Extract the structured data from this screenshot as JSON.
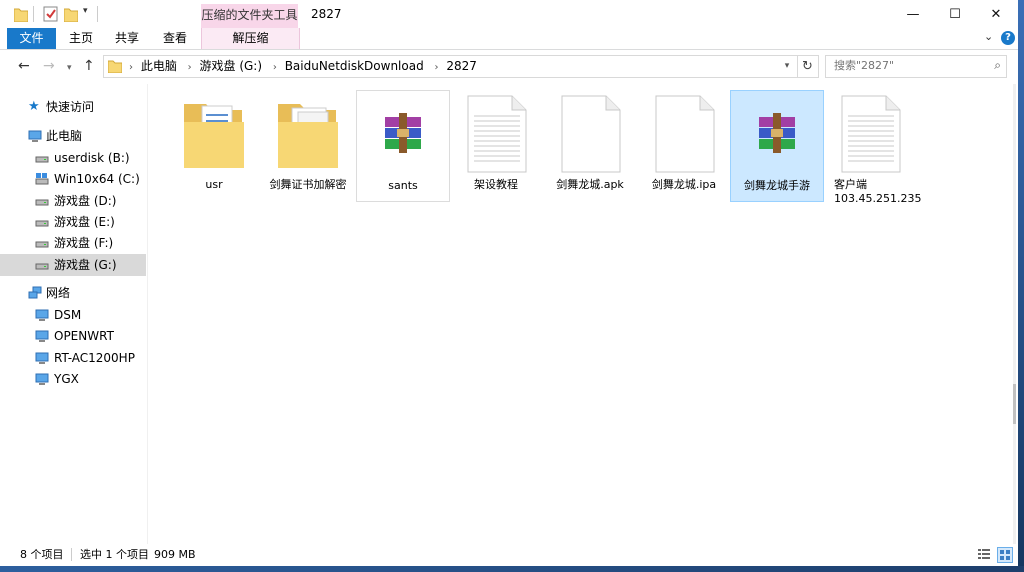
{
  "window": {
    "title": "2827",
    "context_tab_group": "压缩的文件夹工具",
    "controls": {
      "minimize": "—",
      "maximize": "☐",
      "close": "✕"
    }
  },
  "ribbon": {
    "tabs": [
      {
        "label": "文件"
      },
      {
        "label": "主页"
      },
      {
        "label": "共享"
      },
      {
        "label": "查看"
      },
      {
        "label": "解压缩"
      }
    ],
    "collapse_glyph": "⌄",
    "help_glyph": "?"
  },
  "address": {
    "crumbs": [
      "此电脑",
      "游戏盘 (G:)",
      "BaiduNetdiskDownload",
      "2827"
    ]
  },
  "search": {
    "placeholder": "搜索\"2827\""
  },
  "nav_pane": {
    "quick_access": "快速访问",
    "this_pc": "此电脑",
    "drives": [
      {
        "label": "userdisk (B:)"
      },
      {
        "label": "Win10x64 (C:)"
      },
      {
        "label": "游戏盘 (D:)"
      },
      {
        "label": "游戏盘 (E:)"
      },
      {
        "label": "游戏盘 (F:)"
      },
      {
        "label": "游戏盘 (G:)"
      }
    ],
    "network": "网络",
    "network_items": [
      {
        "label": "DSM"
      },
      {
        "label": "OPENWRT"
      },
      {
        "label": "RT-AC1200HP"
      },
      {
        "label": "YGX"
      }
    ]
  },
  "files": [
    {
      "name": "usr",
      "kind": "folder-docs"
    },
    {
      "name": "剑舞证书加解密",
      "kind": "folder-docs"
    },
    {
      "name": "sants",
      "kind": "rar"
    },
    {
      "name": "架设教程",
      "kind": "text-doc"
    },
    {
      "name": "剑舞龙城.apk",
      "kind": "blank-doc"
    },
    {
      "name": "剑舞龙城.ipa",
      "kind": "blank-doc"
    },
    {
      "name": "剑舞龙城手游",
      "kind": "rar",
      "selected": true
    },
    {
      "name": "客户端",
      "name2": "103.45.251.235",
      "kind": "text-doc"
    }
  ],
  "status": {
    "item_count": "8 个项目",
    "selection": "选中 1 个项目",
    "size": "909 MB"
  }
}
